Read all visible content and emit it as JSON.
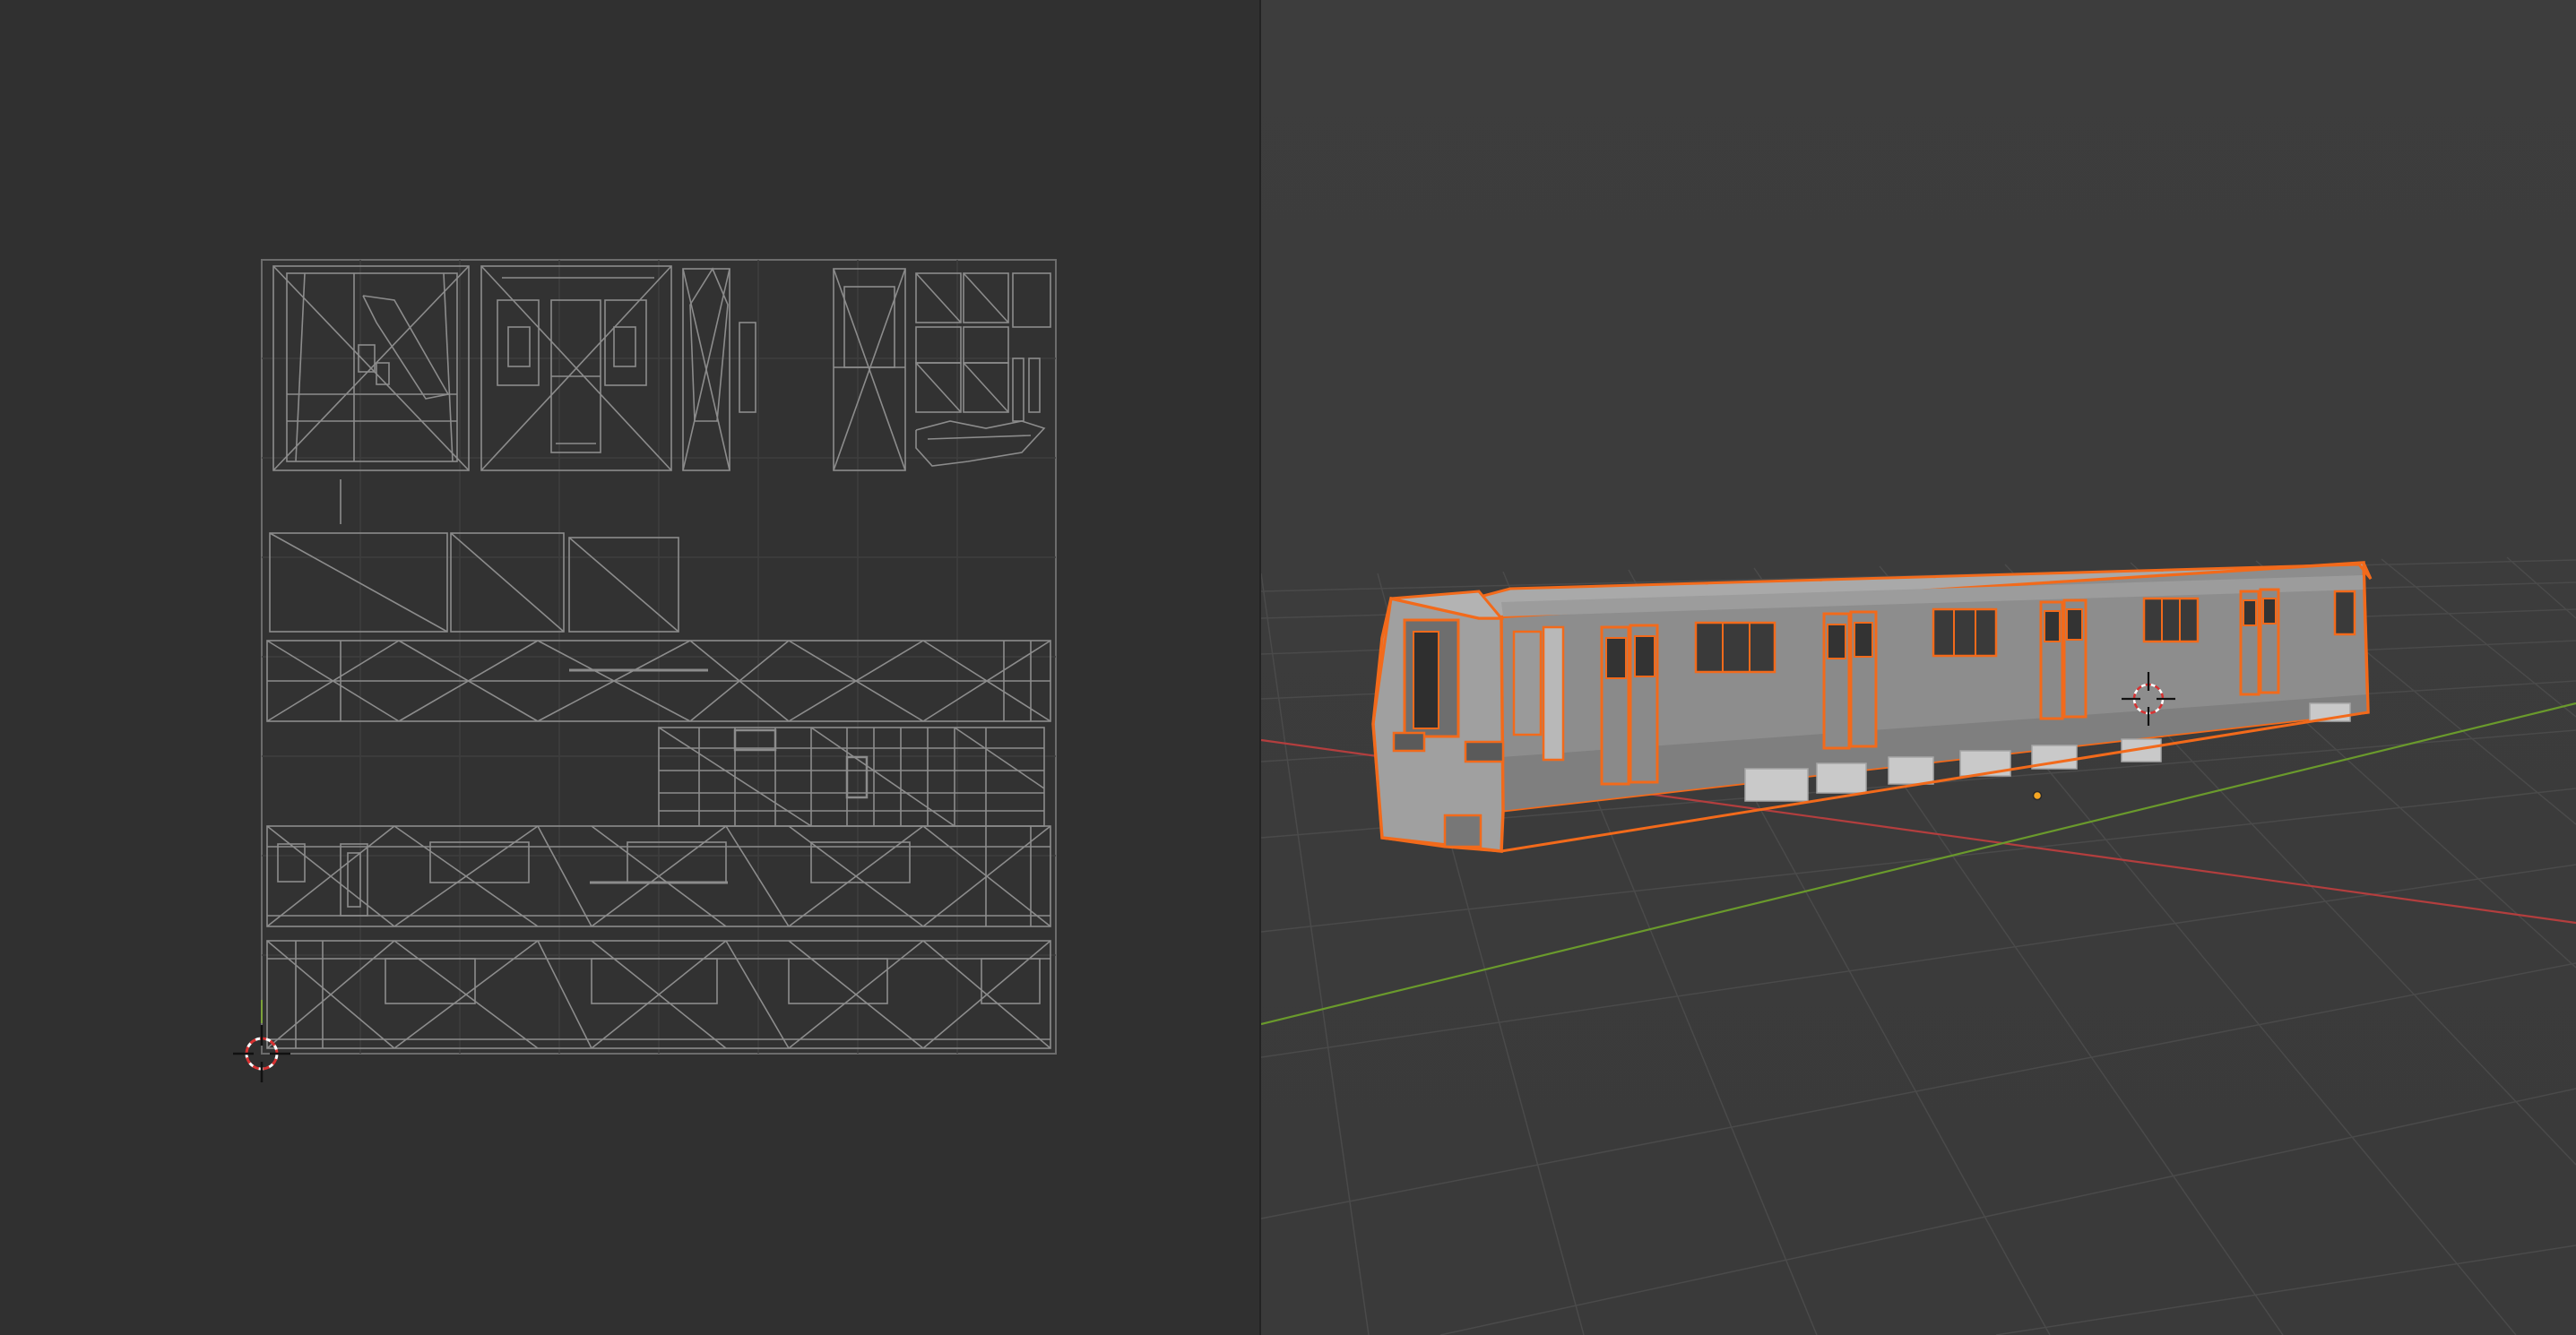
{
  "colors": {
    "uv_background": "#303030",
    "uv_grid": "#3e3e3e",
    "uv_wire": "#8c8c8c",
    "viewport_background": "#3d3d3d",
    "viewport_grid": "#4a4a4a",
    "axis_x": "#b33e3e",
    "axis_y": "#6a9a2c",
    "selection_outline": "#f26a1b",
    "mesh_surface": "#8d8d8d",
    "origin_point": "#f5a623"
  },
  "icons": {
    "uv_cursor": "3d-cursor-icon",
    "viewport_cursor": "3d-cursor-icon",
    "object_origin": "origin-dot-icon"
  }
}
